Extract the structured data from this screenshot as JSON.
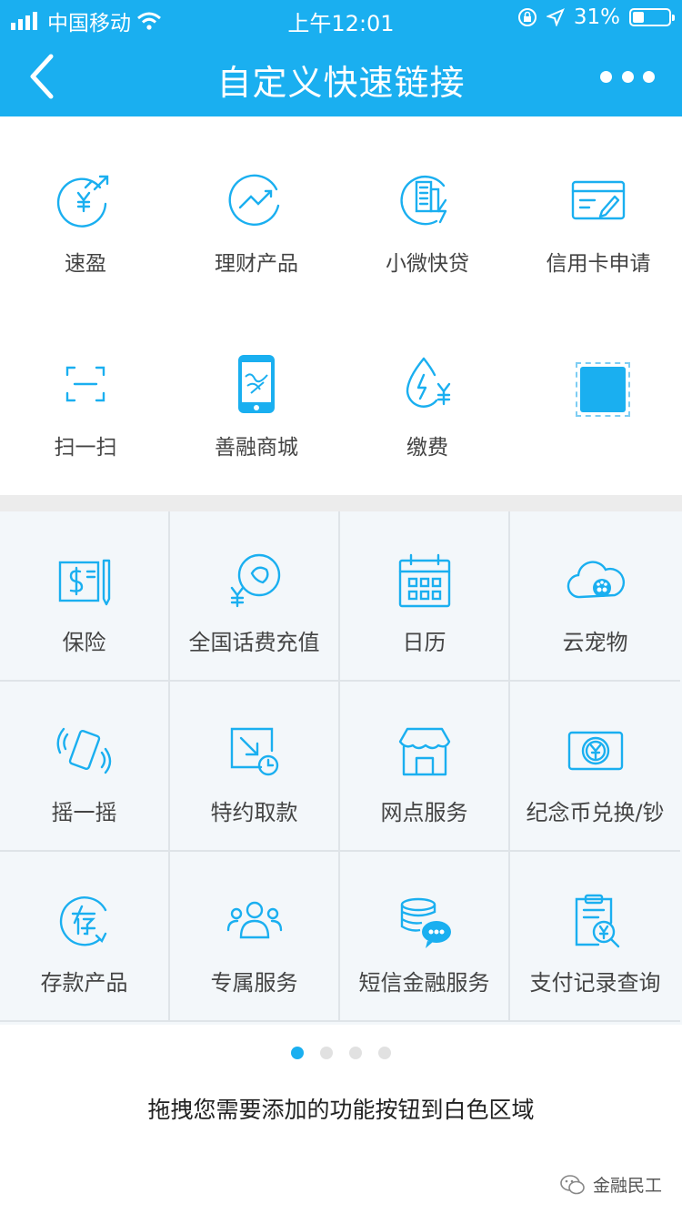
{
  "status": {
    "carrier": "中国移动",
    "time": "上午12:01",
    "battery": "31%",
    "battery_level": 0.31
  },
  "header": {
    "title": "自定义快速链接"
  },
  "quick_links": [
    {
      "label": "速盈",
      "icon": "yuan-arrows-icon"
    },
    {
      "label": "理财产品",
      "icon": "trend-chart-icon"
    },
    {
      "label": "小微快贷",
      "icon": "building-bolt-icon"
    },
    {
      "label": "信用卡申请",
      "icon": "card-pen-icon"
    },
    {
      "label": "扫一扫",
      "icon": "scan-icon"
    },
    {
      "label": "善融商城",
      "icon": "phone-mall-icon"
    },
    {
      "label": "缴费",
      "icon": "water-yuan-icon"
    }
  ],
  "functions": [
    {
      "label": "保险",
      "icon": "insurance-icon"
    },
    {
      "label": "全国话费充值",
      "icon": "phone-recharge-icon"
    },
    {
      "label": "日历",
      "icon": "calendar-icon"
    },
    {
      "label": "云宠物",
      "icon": "cloud-pet-icon"
    },
    {
      "label": "摇一摇",
      "icon": "shake-phone-icon"
    },
    {
      "label": "特约取款",
      "icon": "withdraw-clock-icon"
    },
    {
      "label": "网点服务",
      "icon": "branch-store-icon"
    },
    {
      "label": "纪念币兑换/钞",
      "icon": "coin-exchange-icon"
    },
    {
      "label": "存款产品",
      "icon": "deposit-icon"
    },
    {
      "label": "专属服务",
      "icon": "group-users-icon"
    },
    {
      "label": "短信金融服务",
      "icon": "sms-coins-icon"
    },
    {
      "label": "支付记录查询",
      "icon": "payment-record-icon"
    }
  ],
  "pager": {
    "pages": 4,
    "current": 0
  },
  "hint": "拖拽您需要添加的功能按钮到白色区域",
  "watermark": "金融民工",
  "colors": {
    "brand": "#1aaff0",
    "grid_bg": "#f3f7fa",
    "separator": "#ececec"
  }
}
